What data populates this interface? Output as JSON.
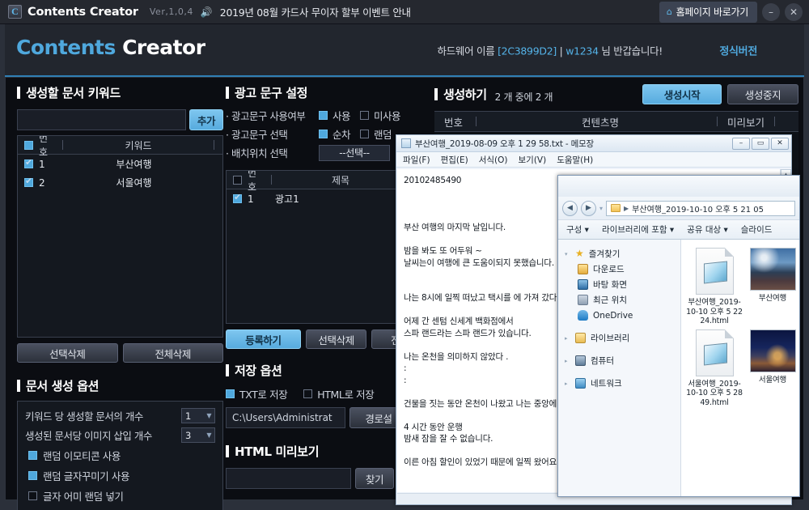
{
  "titlebar": {
    "logo_text": "C",
    "app_title": "Contents Creator",
    "version": "Ver,1,0,4",
    "speaker_icon": "speaker-icon",
    "notice": "2019년 08월 카드사 무이자 할부 이벤트 안내",
    "home_button": "홈페이지 바로가기",
    "home_icon": "home-icon",
    "minimize": "–",
    "close": "✕"
  },
  "header": {
    "brand_first": "Contents ",
    "brand_second": "Creator",
    "hw_label": "하드웨어 이름 ",
    "hw_id": "[2C3899D2]",
    "separator": " | ",
    "user_id": "w1234",
    "greeting": " 님 반갑습니다!",
    "version_tag": "정식버전"
  },
  "keywords_panel": {
    "title": "생성할 문서 키워드",
    "input_value": "",
    "input_placeholder": "",
    "add_button": "추가",
    "columns": [
      "번호",
      "키워드"
    ],
    "rows": [
      {
        "no": "1",
        "keyword": "부산여행",
        "checked": true
      },
      {
        "no": "2",
        "keyword": "서울여행",
        "checked": true
      }
    ],
    "delete_selected": "선택삭제",
    "delete_all": "전체삭제"
  },
  "doc_options": {
    "title": "문서 생성 옵션",
    "per_keyword_label": "키워드 당 생성할 문서의 개수",
    "per_keyword_value": "1",
    "images_label": "생성된 문서당 이미지 삽입 개수",
    "images_value": "3",
    "checks": [
      {
        "label": "랜덤 이모티콘 사용",
        "checked": true
      },
      {
        "label": "랜덤 글자꾸미기 사용",
        "checked": true
      },
      {
        "label": "글자 어미 랜덤 넣기",
        "checked": false
      }
    ]
  },
  "ad_panel": {
    "title": "광고 문구 설정",
    "rows": [
      {
        "label": "· 광고문구 사용여부",
        "options": [
          {
            "label": "사용",
            "checked": true
          },
          {
            "label": "미사용",
            "checked": false
          }
        ]
      },
      {
        "label": "· 광고문구 선택",
        "options": [
          {
            "label": "순차",
            "checked": true
          },
          {
            "label": "랜덤",
            "checked": false
          }
        ]
      }
    ],
    "position_label": "· 배치위치 선택",
    "position_value": "--선택--",
    "columns": [
      "번호",
      "제목"
    ],
    "list_rows": [
      {
        "no": "1",
        "title": "광고1",
        "checked": true
      }
    ],
    "register_button": "등록하기",
    "delete_selected": "선택삭제",
    "delete_all": "전체"
  },
  "save_options": {
    "title": "저장 옵션",
    "txt_label": "TXT로 저장",
    "txt_checked": true,
    "html_label": "HTML로 저장",
    "html_checked": false,
    "path_value": "C:\\Users\\Administrat",
    "path_button": "경로설"
  },
  "html_preview": {
    "title": "HTML 미리보기",
    "input_value": "",
    "find_button": "찾기"
  },
  "generate_panel": {
    "title": "생성하기",
    "count_text": "2 개  중에  2 개",
    "start_button": "생성시작",
    "stop_button": "생성중지",
    "columns": [
      "번호",
      "컨텐츠명",
      "미리보기"
    ]
  },
  "notepad": {
    "title": "부산여행_2019-08-09 오후 1 29 58.txt - 메모장",
    "icon": "notepad-icon",
    "window_buttons": [
      "–",
      "▭",
      "✕"
    ],
    "menu": [
      "파일(F)",
      "편집(E)",
      "서식(O)",
      "보기(V)",
      "도움말(H)"
    ],
    "content": "20102485490\n\n\n\n부산 여행의 마지막 날입니다.\n\n밤을 봐도 또 어두워 ~\n날씨는이 여행에 큰 도움이되지 못했습니다.\n\n\n나는 8시에 일찍 떠났고 택시를 에 가져 갔다\n\n어제 간 센텀 신세계 백화점에서\n스파 랜드라는 스파 랜드가 있습니다.\n\n나는 온천을 의미하지 않았다 .\n:\n:\n\n건물을 짓는 동안 온천이 나왔고 나는 중앙에\n\n4 시간 동안 운행\n밤새 잠을 잘 수 없습니다.\n\n이른 아침 할인이 있었기 때문에 일찍 왔어요\n\n\n\n스파 랜드\n\n\n\n이모가 두 장의 무료 티켓을 했어\n할인을받은 사람의 입장료 만 지불하면됩니다"
  },
  "explorer": {
    "back_icon": "back-arrow-icon",
    "forward_icon": "forward-arrow-icon",
    "address_path": "부산여행_2019-10-10 오후 5 21 05",
    "toolbar": [
      "구성 ▾",
      "라이브러리에 포함 ▾",
      "공유 대상 ▾",
      "슬라이드"
    ],
    "nav_items": [
      {
        "label": "즐겨찾기",
        "icon": "star-icon",
        "level": 0
      },
      {
        "label": "다운로드",
        "icon": "download-folder-icon",
        "level": 1
      },
      {
        "label": "바탕 화면",
        "icon": "desktop-icon",
        "level": 1
      },
      {
        "label": "최근 위치",
        "icon": "recent-places-icon",
        "level": 1
      },
      {
        "label": "OneDrive",
        "icon": "onedrive-icon",
        "level": 1
      },
      {
        "label": "라이브러리",
        "icon": "library-icon",
        "level": 0
      },
      {
        "label": "컴퓨터",
        "icon": "computer-icon",
        "level": 0
      },
      {
        "label": "네트워크",
        "icon": "network-icon",
        "level": 0
      }
    ],
    "files": [
      {
        "name": "부산여행_2019-10-10 오후 5 22 24.html",
        "type": "html"
      },
      {
        "name": "부산여행",
        "type": "image-busan"
      },
      {
        "name": "서울여행_2019-10-10 오후 5 28 49.html",
        "type": "html"
      },
      {
        "name": "서울여행",
        "type": "image-seoul"
      }
    ]
  },
  "colors": {
    "accent_blue": "#4fa8dd",
    "panel_dark": "#0b0d12",
    "titlebar": "#25282f",
    "button_blue": "#57abde"
  }
}
